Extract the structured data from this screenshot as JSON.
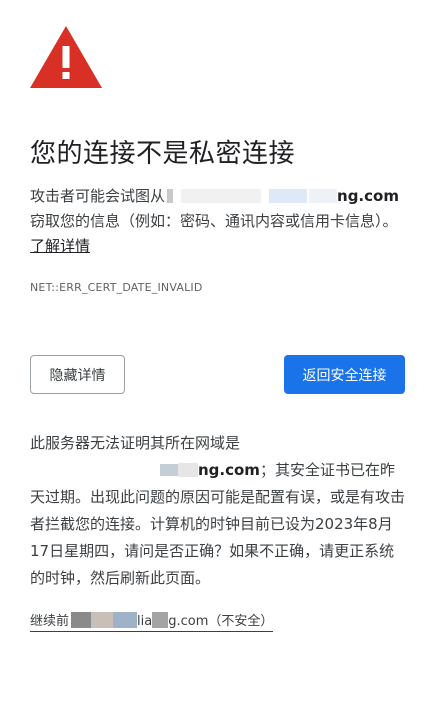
{
  "heading": "您的连接不是私密连接",
  "warning": {
    "prefix": "攻击者可能会试图从",
    "domain_suffix": "ng.com",
    "rest": "窃取您的信息（例如：密码、通讯内容或信用卡信息）。",
    "learn_more": "了解详情"
  },
  "error_code": "NET::ERR_CERT_DATE_INVALID",
  "buttons": {
    "hide_details": "隐藏详情",
    "back_to_safety": "返回安全连接"
  },
  "details": {
    "line1": "此服务器无法证明其所在网域是",
    "domain_suffix": "ng.com",
    "rest": "；其安全证书已在昨天过期。出现此问题的原因可能是配置有误，或是有攻击者拦截您的连接。计算机的时钟目前已设为2023年8月17日星期四，请问是否正确？如果不正确，请更正系统的时钟，然后刷新此页面。"
  },
  "proceed": {
    "prefix": "继续前",
    "mid": "lia",
    "suffix": "g.com（不安全）"
  },
  "colors": {
    "warning_red": "#d93025",
    "primary_blue": "#1a73e8"
  }
}
